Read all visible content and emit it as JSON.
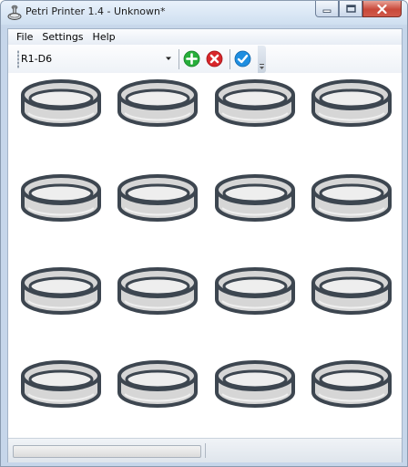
{
  "window": {
    "title": "Petri Printer 1.4 - Unknown*",
    "app_icon": "flask-icon",
    "controls": [
      "minimize-icon",
      "maximize-icon",
      "close-icon"
    ]
  },
  "menu": {
    "items": [
      {
        "label": "File"
      },
      {
        "label": "Settings"
      },
      {
        "label": "Help"
      }
    ]
  },
  "toolbar": {
    "layout_select": {
      "value": "R1-D6",
      "icon": "chevron-down-icon"
    },
    "buttons": [
      {
        "name": "add-button",
        "icon": "plus-circle-icon",
        "color": "#27ae3a"
      },
      {
        "name": "remove-button",
        "icon": "x-circle-icon",
        "color": "#d8262a"
      },
      {
        "name": "confirm-button",
        "icon": "checkmark-circle-icon",
        "color": "#1f8ee0"
      }
    ],
    "overflow_icon": "chevron-down-icon"
  },
  "plate_grid": {
    "rows": 4,
    "columns": 4,
    "dish_icon": "petri-dish-icon",
    "dish_fill": "#d6d6d6",
    "dish_stroke": "#3d4650"
  },
  "status": {
    "progress_percent": 0,
    "text": ""
  }
}
